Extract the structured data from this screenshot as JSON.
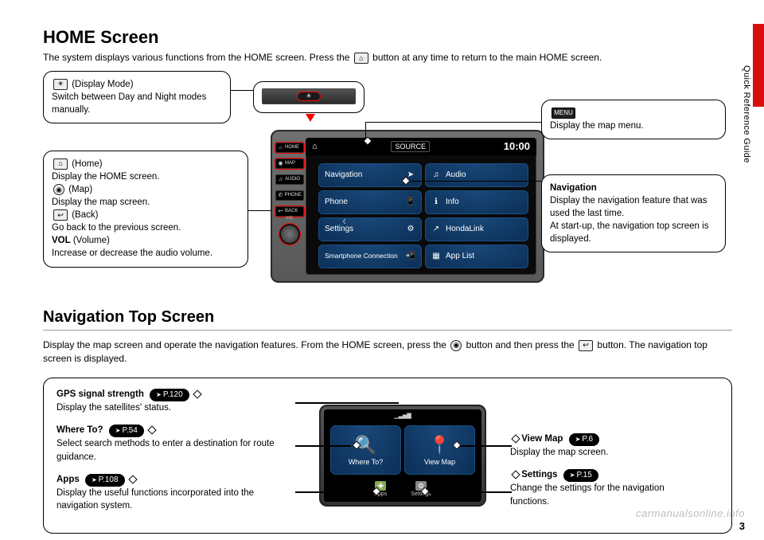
{
  "side_label": "Quick Reference Guide",
  "page_number": "3",
  "watermark": "carmanualsonline.info",
  "section1": {
    "title": "HOME Screen",
    "intro_a": "The system displays various functions from the HOME screen. Press the ",
    "intro_b": " button at any time to return to the main HOME screen."
  },
  "callouts": {
    "display_mode": {
      "label": "(Display Mode)",
      "text": "Switch between Day and Night modes manually."
    },
    "home": {
      "label": "(Home)",
      "text": "Display the HOME screen."
    },
    "map": {
      "label": "(Map)",
      "text": "Display the map screen."
    },
    "back": {
      "label": "(Back)",
      "text": "Go back to the previous screen."
    },
    "vol": {
      "label": "VOL",
      "desc": "(Volume)",
      "text": "Increase or decrease the audio volume."
    },
    "menu": {
      "label": "MENU",
      "text": "Display the map menu."
    },
    "navigation": {
      "title": "Navigation",
      "text": "Display the navigation feature that was used the last time.\nAt start-up, the navigation top screen is displayed."
    }
  },
  "hw_buttons": [
    "HOME",
    "MAP",
    "AUDIO",
    "PHONE",
    "BACK"
  ],
  "device": {
    "source": "SOURCE",
    "clock": "10:00",
    "tiles": [
      {
        "icon": "➤",
        "label": "Navigation"
      },
      {
        "icon": "♫",
        "label": "Audio"
      },
      {
        "icon": "✆",
        "label": "Phone"
      },
      {
        "icon": "i",
        "label": "Info"
      },
      {
        "icon": "⚙",
        "label": "Settings"
      },
      {
        "icon": "H",
        "label": "HondaLink"
      },
      {
        "icon": "📱",
        "label": "Smartphone Connection"
      },
      {
        "icon": "▦",
        "label": "App List"
      }
    ]
  },
  "section2": {
    "title": "Navigation Top Screen",
    "intro_a": "Display the map screen and operate the navigation features. From the HOME screen, press the ",
    "intro_b": " button and then press the ",
    "intro_c": " button. The navigation top screen is displayed."
  },
  "nav": {
    "gps": {
      "title": "GPS signal strength",
      "pref": "P.120",
      "text": "Display the satellites' status."
    },
    "where": {
      "title": "Where To?",
      "pref": "P.54",
      "text": "Select search methods to enter a destination for route guidance."
    },
    "apps": {
      "title": "Apps",
      "pref": "P.108",
      "text": "Display the useful functions incorporated into the navigation system."
    },
    "view": {
      "title": "View Map",
      "pref": "P.6",
      "text": "Display the map screen."
    },
    "settings": {
      "title": "Settings",
      "pref": "P.15",
      "text": "Change the settings for the navigation functions."
    },
    "screen": {
      "where_label": "Where To?",
      "view_label": "View Map",
      "apps_label": "Apps",
      "settings_label": "Settings"
    }
  }
}
